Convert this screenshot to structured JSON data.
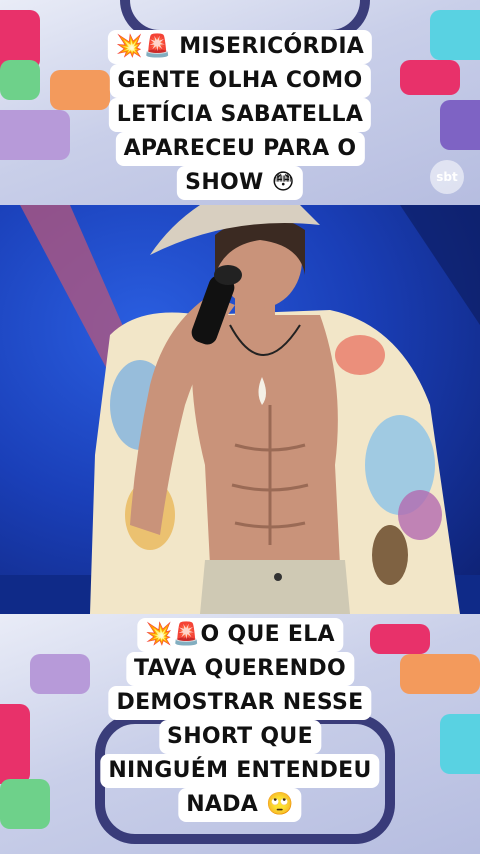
{
  "watermark": {
    "text": "sbt"
  },
  "caption_top": {
    "lines": [
      "💥🚨 MISERICÓRDIA",
      "GENTE OLHA COMO",
      "LETÍCIA SABATELLA",
      "APARECEU PARA O",
      "SHOW 😳"
    ]
  },
  "caption_bottom": {
    "lines": [
      "💥🚨O QUE ELA",
      "TAVA QUERENDO",
      "DEMOSTRAR NESSE",
      "SHORT QUE",
      "NINGUÉM ENTENDEU",
      "NADA 🙄"
    ]
  },
  "colors": {
    "stage_blue": "#1a3fb8",
    "shirt_base": "#f2e6c8",
    "skin": "#c9937a",
    "hat": "#d8cfc0"
  },
  "photo": {
    "subject": "performer-on-stage-with-microphone"
  }
}
